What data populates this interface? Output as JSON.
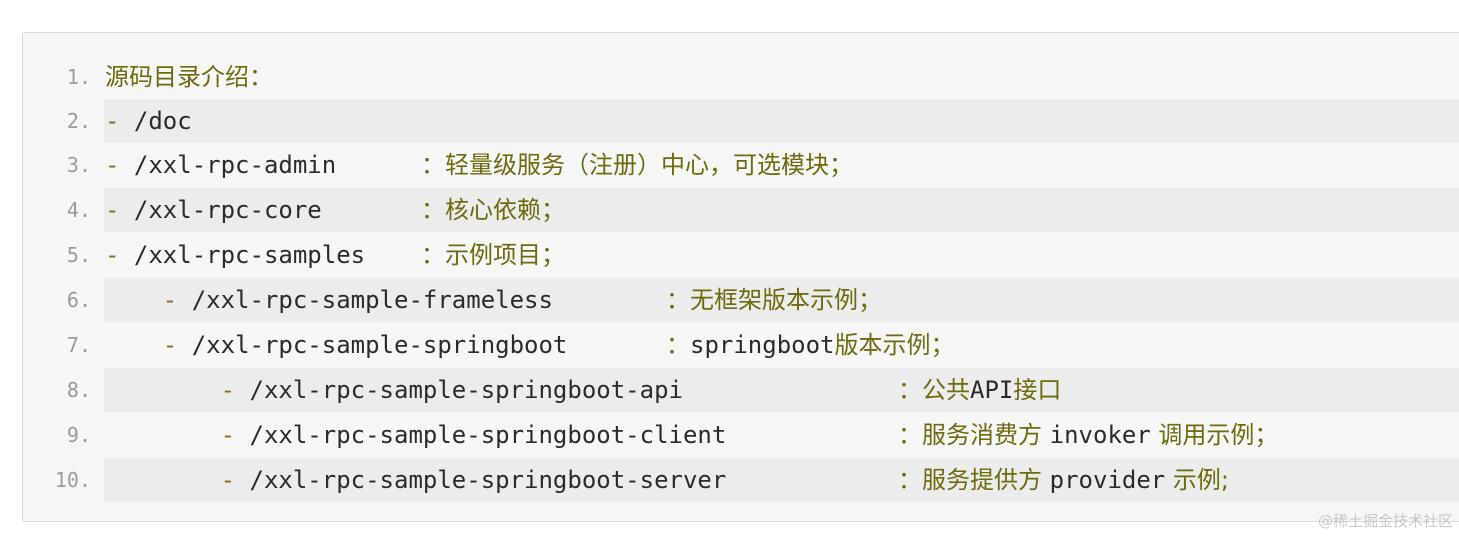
{
  "code_block": {
    "lines": [
      {
        "number": "1.",
        "dash": "",
        "path": "",
        "heading": "源码目录介绍：",
        "desc": ""
      },
      {
        "number": "2.",
        "dash": "- ",
        "path": "/doc",
        "heading": "",
        "desc": ""
      },
      {
        "number": "3.",
        "dash": "- ",
        "path": "/xxl-rpc-admin",
        "heading": "",
        "desc": "：轻量级服务（注册）中心，可选模块；"
      },
      {
        "number": "4.",
        "dash": "- ",
        "path": "/xxl-rpc-core",
        "heading": "",
        "desc": "：核心依赖；"
      },
      {
        "number": "5.",
        "dash": "- ",
        "path": "/xxl-rpc-samples",
        "heading": "",
        "desc": "：示例项目；"
      },
      {
        "number": "6.",
        "dash": "    - ",
        "path": "/xxl-rpc-sample-frameless",
        "heading": "",
        "desc": "：无框架版本示例；"
      },
      {
        "number": "7.",
        "dash": "    - ",
        "path": "/xxl-rpc-sample-springboot",
        "heading": "",
        "desc_parts": [
          "：",
          "springboot",
          "版本示例；"
        ]
      },
      {
        "number": "8.",
        "dash": "        - ",
        "path": "/xxl-rpc-sample-springboot-api",
        "heading": "",
        "desc_parts": [
          "：公共",
          "API",
          "接口"
        ]
      },
      {
        "number": "9.",
        "dash": "        - ",
        "path": "/xxl-rpc-sample-springboot-client",
        "heading": "",
        "desc_parts": [
          "：服务消费方 ",
          "invoker",
          " 调用示例；"
        ]
      },
      {
        "number": "10.",
        "dash": "        - ",
        "path": "/xxl-rpc-sample-springboot-server",
        "heading": "",
        "desc_parts": [
          "：服务提供方 ",
          "provider",
          " 示例;"
        ]
      }
    ]
  },
  "watermark": "@稀土掘金技术社区",
  "colors": {
    "background": "#f6f6f6",
    "shaded_row": "#ececec",
    "line_number": "#9b9b9b",
    "chinese_text": "#6e6a0d",
    "code_text": "#2b2b2b"
  }
}
